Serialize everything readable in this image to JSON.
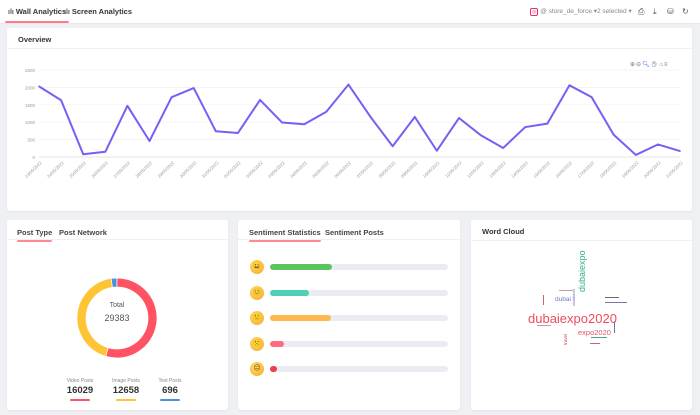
{
  "topbar": {
    "tabs": [
      {
        "label": "Wall Analytics",
        "icon": "bar-chart-icon",
        "active": true
      },
      {
        "label": "Screen Analytics",
        "icon": "bar-chart-icon",
        "active": false
      }
    ],
    "account": "@ store_de_force",
    "account_icon": "instagram-icon",
    "selected": "2 selected",
    "actions": [
      "print-icon",
      "download-icon",
      "database-icon",
      "refresh-icon"
    ]
  },
  "overview": {
    "title": "Overview",
    "toolbar": [
      "zoom-in-icon",
      "zoom-out-icon",
      "selection-zoom-icon",
      "pan-icon",
      "reset-home-icon",
      "menu-icon"
    ]
  },
  "chart_data": {
    "type": "line",
    "color": "#7b5cf5",
    "ylim": [
      0,
      2500
    ],
    "yticks": [
      0,
      500,
      1000,
      1500,
      2000,
      2500
    ],
    "grid": true,
    "x": [
      "23/05/2022",
      "24/05/2022",
      "25/05/2022",
      "26/05/2022",
      "27/05/2022",
      "28/05/2022",
      "29/05/2022",
      "30/05/2022",
      "31/05/2022",
      "01/06/2022",
      "02/06/2022",
      "03/06/2022",
      "04/06/2022",
      "05/06/2022",
      "06/06/2022",
      "07/06/2022",
      "08/06/2022",
      "09/06/2022",
      "10/06/2022",
      "11/06/2022",
      "12/06/2022",
      "13/06/2022",
      "14/06/2022",
      "15/06/2022",
      "16/06/2022",
      "17/06/2022",
      "18/06/2022",
      "19/06/2022",
      "20/06/2022",
      "21/06/2022"
    ],
    "values": [
      2030,
      1630,
      80,
      150,
      1470,
      460,
      1720,
      1980,
      740,
      690,
      1640,
      990,
      940,
      1300,
      2080,
      1150,
      310,
      1150,
      180,
      1120,
      620,
      260,
      860,
      960,
      2060,
      1720,
      640,
      60,
      360,
      170
    ]
  },
  "post_type": {
    "tabs": [
      "Post Type",
      "Post Network"
    ],
    "total_label": "Total",
    "total": "29383",
    "items": [
      {
        "label": "Video Posts",
        "value": "16029",
        "num": 16029,
        "color": "#ff5263"
      },
      {
        "label": "Image Posts",
        "value": "12658",
        "num": 12658,
        "color": "#ffc435"
      },
      {
        "label": "Text Posts",
        "value": "696",
        "num": 696,
        "color": "#4a90e2"
      }
    ]
  },
  "sentiment": {
    "tabs": [
      "Sentiment Statistics",
      "Sentiment Posts"
    ],
    "rows": [
      {
        "icon": "grinning-face-icon",
        "glyph": "😀",
        "percent": 35,
        "color": "#5cc45c"
      },
      {
        "icon": "smiling-face-icon",
        "glyph": "😊",
        "percent": 22,
        "color": "#4dd0b5"
      },
      {
        "icon": "slightly-smiling-face-icon",
        "glyph": "🙂",
        "percent": 34,
        "color": "#ffb84d"
      },
      {
        "icon": "slightly-frowning-face-icon",
        "glyph": "🙁",
        "percent": 8,
        "color": "#ff6b81"
      },
      {
        "icon": "frowning-face-icon",
        "glyph": "☹",
        "percent": 2,
        "color": "#f03c50"
      }
    ]
  },
  "word_cloud": {
    "title": "Word Cloud",
    "words": [
      "dubaiexpo2020",
      "dubaiexpo",
      "expo2020",
      "dubai",
      "visitdubai",
      "travel"
    ]
  }
}
